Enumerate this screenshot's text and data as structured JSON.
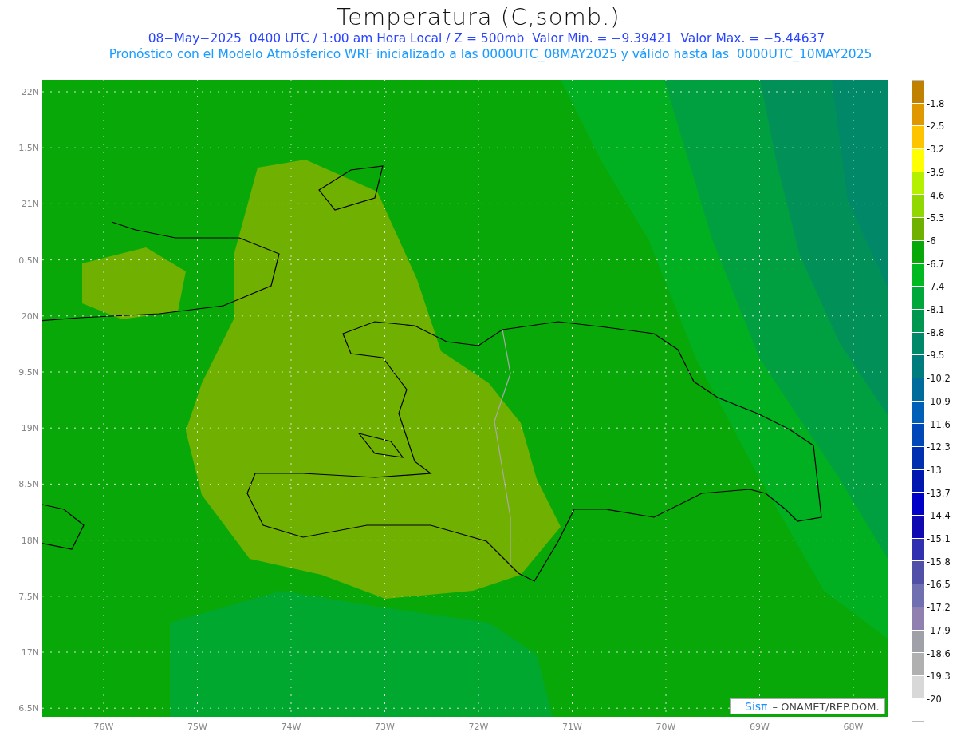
{
  "title": "Temperatura (C,somb.)",
  "subtitle": "08−May−2025  0400 UTC / 1:00 am Hora Local / Z = 500mb  Valor Min. = −9.39421  Valor Max. = −5.44637",
  "description": "Pronóstico con el Modelo Atmósferico WRF inicializado a las 0000UTC_08MAY2025 y válido hasta las  0000UTC_10MAY2025",
  "map": {
    "y_labels": [
      "22N",
      "1.5N",
      "21N",
      "0.5N",
      "20N",
      "9.5N",
      "19N",
      "8.5N",
      "18N",
      "7.5N",
      "17N",
      "6.5N"
    ],
    "x_labels": [
      "76W",
      "75W",
      "74W",
      "73W",
      "72W",
      "71W",
      "70W",
      "69W",
      "68W"
    ],
    "credit": {
      "logo": "Sisπ",
      "text": "– ONAMET/REP.DOM."
    }
  },
  "colorbar": {
    "boxes": [
      {
        "color": "#c08000"
      },
      {
        "color": "#e09800"
      },
      {
        "color": "#ffc400"
      },
      {
        "color": "#ffff00"
      },
      {
        "color": "#b4f000"
      },
      {
        "color": "#90d800"
      },
      {
        "color": "#70b000"
      },
      {
        "color": "#08a808"
      },
      {
        "color": "#00b820"
      },
      {
        "color": "#00a83c"
      },
      {
        "color": "#009850"
      },
      {
        "color": "#008868"
      },
      {
        "color": "#007c7c"
      },
      {
        "color": "#006c9c"
      },
      {
        "color": "#0060b8"
      },
      {
        "color": "#0048b8"
      },
      {
        "color": "#0030b0"
      },
      {
        "color": "#0018b0"
      },
      {
        "color": "#0000c8"
      },
      {
        "color": "#1008b0"
      },
      {
        "color": "#3030b0"
      },
      {
        "color": "#5050a8"
      },
      {
        "color": "#7070b0"
      },
      {
        "color": "#9080b0"
      },
      {
        "color": "#a0a0a8"
      },
      {
        "color": "#b0b0b0"
      },
      {
        "color": "#d8d8d8"
      },
      {
        "color": "#ffffff"
      }
    ],
    "labels": [
      "-1.8",
      "-2.5",
      "-3.2",
      "-3.9",
      "-4.6",
      "-5.3",
      "-6",
      "-6.7",
      "-7.4",
      "-8.1",
      "-8.8",
      "-9.5",
      "-10.2",
      "-10.9",
      "-11.6",
      "-12.3",
      "-13",
      "-13.7",
      "-14.4",
      "-15.1",
      "-15.8",
      "-16.5",
      "-17.2",
      "-17.9",
      "-18.6",
      "-19.3",
      "-20"
    ]
  }
}
